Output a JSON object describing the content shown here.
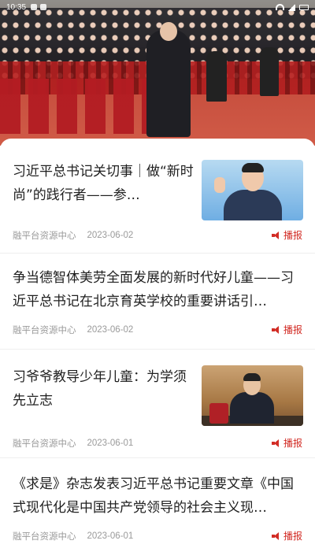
{
  "status_bar": {
    "time": "10:35"
  },
  "hero": {
    "image_subject": "大会堂会议现场"
  },
  "feed": {
    "items": [
      {
        "title": "习近平总书记关切事｜做“新时尚”的践行者——参…",
        "source": "融平台资源中心",
        "date": "2023-06-02",
        "broadcast_label": "播报",
        "has_thumbnail": true
      },
      {
        "title": "争当德智体美劳全面发展的新时代好儿童——习近平总书记在北京育英学校的重要讲话引…",
        "source": "融平台资源中心",
        "date": "2023-06-02",
        "broadcast_label": "播报",
        "has_thumbnail": false
      },
      {
        "title": "习爷爷教导少年儿童：为学须先立志",
        "source": "融平台资源中心",
        "date": "2023-06-01",
        "broadcast_label": "播报",
        "has_thumbnail": true
      },
      {
        "title": "《求是》杂志发表习近平总书记重要文章《中国式现代化是中国共产党领导的社会主义现…",
        "source": "融平台资源中心",
        "date": "2023-06-01",
        "broadcast_label": "播报",
        "has_thumbnail": false
      }
    ]
  },
  "colors": {
    "accent": "#d22c25",
    "meta_text": "#9a9a9a",
    "title_text": "#1f1f1f"
  }
}
